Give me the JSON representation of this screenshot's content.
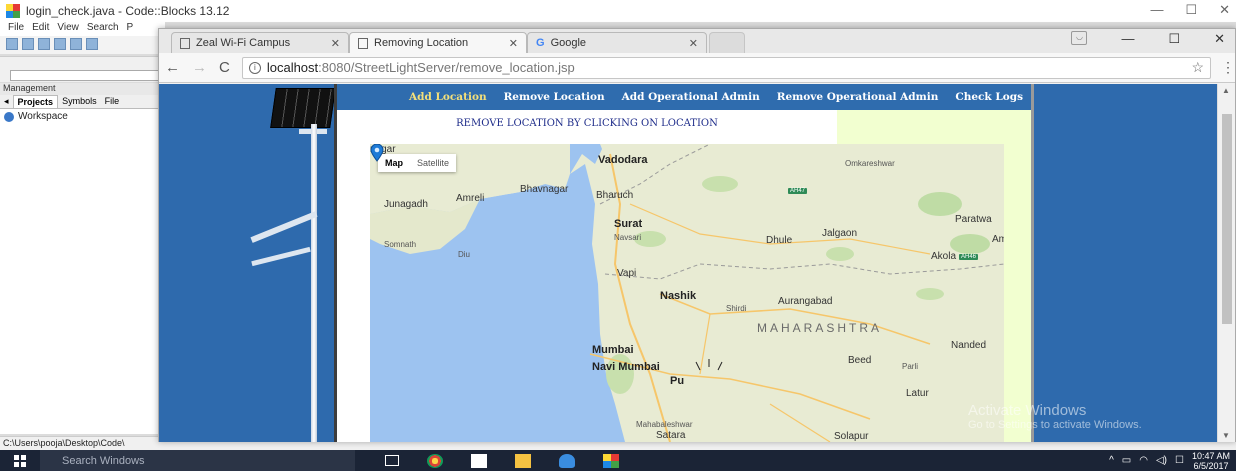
{
  "codeblocks": {
    "title": "login_check.java - Code::Blocks 13.12",
    "menu": [
      "File",
      "Edit",
      "View",
      "Search",
      "P"
    ],
    "management_label": "Management",
    "tabs": [
      "Projects",
      "Symbols",
      "File"
    ],
    "workspace_label": "Workspace",
    "status_path": "C:\\Users\\pooja\\Desktop\\Code\\"
  },
  "chrome": {
    "tabs": [
      {
        "label": "Zeal Wi-Fi Campus",
        "active": false
      },
      {
        "label": "Removing Location",
        "active": true
      },
      {
        "label": "Google",
        "active": false
      }
    ],
    "address": {
      "host": "localhost",
      "path": ":8080/StreetLightServer/remove_location.jsp"
    }
  },
  "page": {
    "nav": [
      "Add Location",
      "Remove Location",
      "Add Operational Admin",
      "Remove Operational Admin",
      "Check Logs"
    ],
    "heading": "REMOVE LOCATION BY CLICKING ON LOCATION"
  },
  "map": {
    "toggle": {
      "map": "Map",
      "satellite": "Satellite"
    },
    "region_label": "MAHARASHTRA",
    "cities": [
      "Vadodara",
      "Omkareshwar",
      "Bhavnagar",
      "Bharuch",
      "Junagadh",
      "Amreli",
      "Surat",
      "Navsari",
      "Somnath",
      "Diu",
      "Dhule",
      "Jalgaon",
      "Akola",
      "Vapi",
      "Nashik",
      "Shirdi",
      "Aurangabad",
      "Mumbai",
      "Navi Mumbai",
      "Pu",
      "Beed",
      "Nanded",
      "Parli",
      "Latur",
      "Mahabaleshwar",
      "Satara",
      "Solapur",
      "Paratwa",
      "Am",
      "nagar"
    ],
    "highways": [
      "AH47",
      "AH46"
    ]
  },
  "watermark": {
    "line1": "Activate Windows",
    "line2": "Go to Settings to activate Windows."
  },
  "taskbar": {
    "search_placeholder": "Search Windows",
    "time": "10:47 AM",
    "date": "6/5/2017"
  }
}
